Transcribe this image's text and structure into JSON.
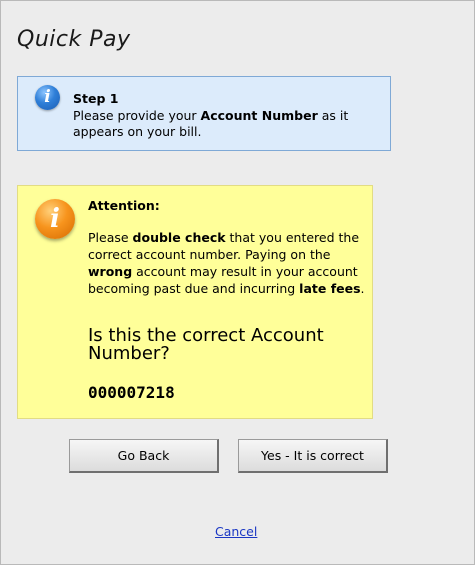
{
  "page": {
    "title": "Quick Pay"
  },
  "info": {
    "icon": "info-icon",
    "heading": "Step 1",
    "text_before": "Please provide your ",
    "text_bold": "Account Number",
    "text_after": " as it appears on your bill."
  },
  "attention": {
    "icon": "warning-info-icon",
    "heading": "Attention:",
    "p1": "Please ",
    "b1": "double check",
    "p2": " that you entered the correct account number. Paying on the ",
    "b2": "wrong",
    "p3": " account may result in your account becoming past due and incurring ",
    "b3": "late fees",
    "p4": ".",
    "question": "Is this the correct Account Number?",
    "account_number": "000007218"
  },
  "buttons": {
    "back_label": "Go Back",
    "confirm_label": "Yes - It is correct"
  },
  "links": {
    "cancel_label": "Cancel"
  },
  "colors": {
    "info_bg": "#dcebfb",
    "info_border": "#7fa9d6",
    "warning_bg": "#ffff99",
    "link": "#1a37c4"
  }
}
